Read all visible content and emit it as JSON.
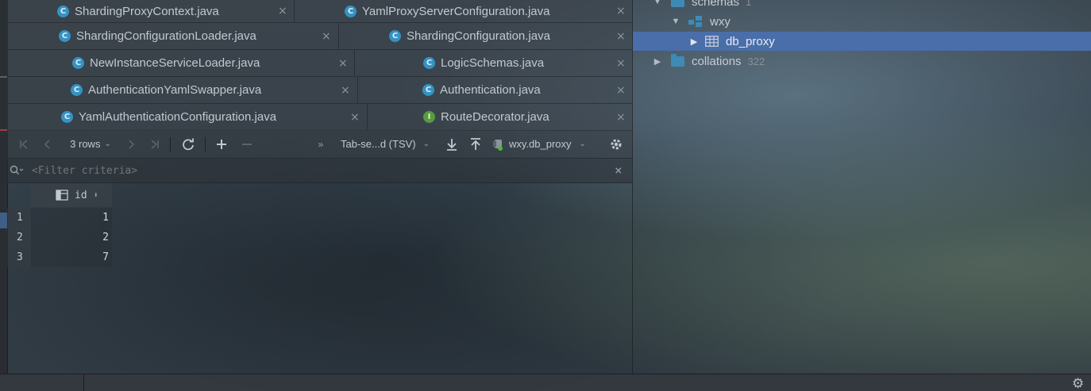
{
  "editor_tabs": {
    "rows": [
      [
        {
          "name": "ShardingProxyContext.java",
          "kind": "class"
        },
        {
          "name": "YamlProxyServerConfiguration.java",
          "kind": "class"
        }
      ],
      [
        {
          "name": "ShardingConfigurationLoader.java",
          "kind": "class"
        },
        {
          "name": "ShardingConfiguration.java",
          "kind": "class"
        }
      ],
      [
        {
          "name": "NewInstanceServiceLoader.java",
          "kind": "class"
        },
        {
          "name": "LogicSchemas.java",
          "kind": "class"
        }
      ],
      [
        {
          "name": "AuthenticationYamlSwapper.java",
          "kind": "class"
        },
        {
          "name": "Authentication.java",
          "kind": "class"
        }
      ],
      [
        {
          "name": "YamlAuthenticationConfiguration.java",
          "kind": "class"
        },
        {
          "name": "RouteDecorator.java",
          "kind": "interface"
        }
      ]
    ],
    "class_glyph": "C",
    "interface_glyph": "I",
    "close_glyph": "×"
  },
  "result_toolbar": {
    "rows_label": "3 rows",
    "export_format": "Tab-se...d (TSV)",
    "datasource": "wxy.db_proxy",
    "icons": [
      "first-page-icon",
      "prev-page-icon",
      "next-page-icon",
      "last-page-icon",
      "refresh-icon",
      "add-row-icon",
      "delete-row-icon",
      "download-icon",
      "upload-icon",
      "datasource-icon",
      "settings-icon"
    ]
  },
  "filter": {
    "placeholder": "<Filter criteria>"
  },
  "result_grid": {
    "columns": [
      "id"
    ],
    "row_numbers": [
      "1",
      "2",
      "3"
    ],
    "rows": [
      [
        "1"
      ],
      [
        "2"
      ],
      [
        "7"
      ]
    ]
  },
  "db_tree": {
    "items": [
      {
        "label": "schemas",
        "count": "1",
        "expanded": true,
        "kind": "folder"
      },
      {
        "label": "wxy",
        "count": "",
        "expanded": true,
        "kind": "schema"
      },
      {
        "label": "db_proxy",
        "count": "",
        "expanded": false,
        "kind": "table",
        "selected": true
      },
      {
        "label": "collations",
        "count": "322",
        "expanded": false,
        "kind": "folder"
      }
    ]
  },
  "colors": {
    "selection": "#4a6ea9",
    "class_icon": "#3592c4",
    "interface_icon": "#5a9a3e",
    "folder_icon": "#3d8bb5"
  }
}
